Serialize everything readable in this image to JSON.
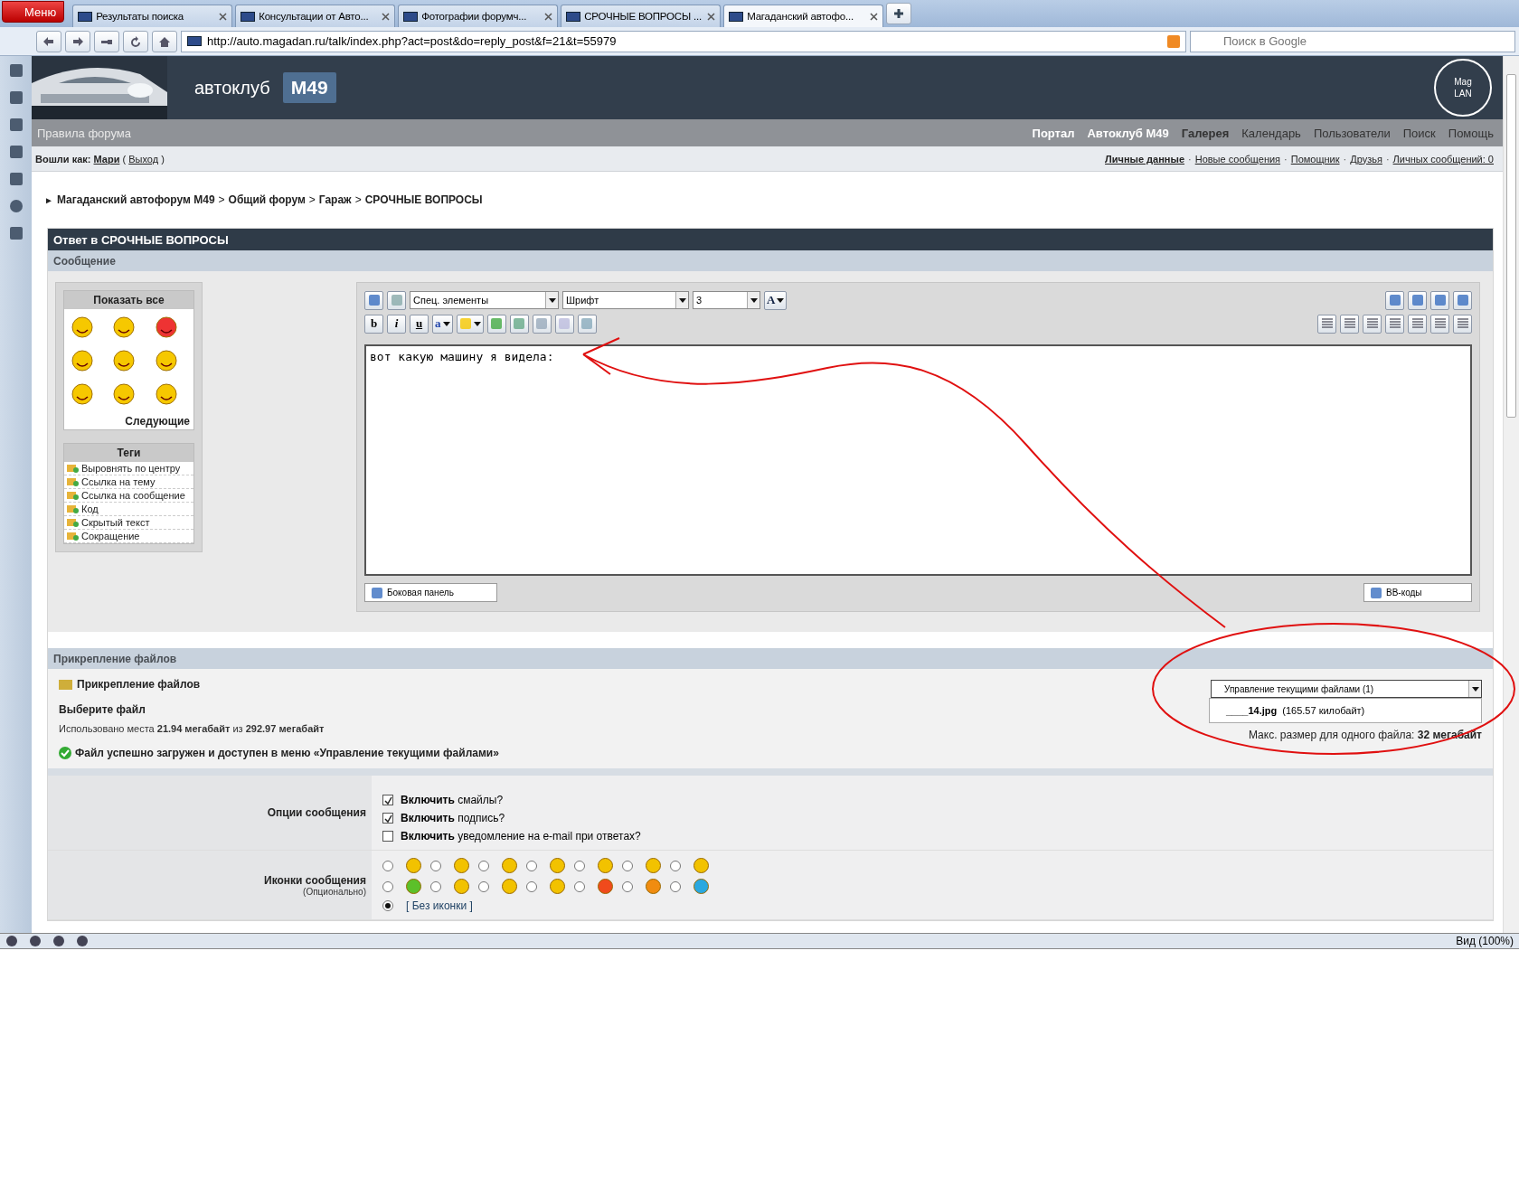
{
  "browser": {
    "menu_button": "Меню",
    "tabs": [
      {
        "label": "Результаты поиска",
        "selected": false
      },
      {
        "label": "Консультации от Авто...",
        "selected": false
      },
      {
        "label": "Фотографии форумч...",
        "selected": false
      },
      {
        "label": "СРОЧНЫЕ ВОПРОСЫ ...",
        "selected": false
      },
      {
        "label": "Магаданский автофо...",
        "selected": true
      }
    ],
    "url": "http://auto.magadan.ru/talk/index.php?act=post&do=reply_post&f=21&t=55979",
    "search_placeholder": "Поиск в Google",
    "zoom": "Вид (100%)"
  },
  "header": {
    "club": "автоклуб",
    "badge": "M49",
    "logo_lines": [
      "Mag",
      "LAN"
    ]
  },
  "nav": {
    "rules": "Правила форума",
    "links": [
      {
        "label": "Портал",
        "kind": "strong"
      },
      {
        "label": "Автоклуб M49",
        "kind": "strong"
      },
      {
        "label": "Галерея",
        "kind": "medium"
      },
      {
        "label": "Календарь",
        "kind": "normal"
      },
      {
        "label": "Пользователи",
        "kind": "normal"
      },
      {
        "label": "Поиск",
        "kind": "normal"
      },
      {
        "label": "Помощь",
        "kind": "normal"
      }
    ]
  },
  "userbar": {
    "label": "Вошли как:",
    "user": "Мари",
    "open": "(",
    "logout": "Выход",
    "close": ")",
    "separator": "·",
    "links": [
      {
        "label": "Личные данные",
        "bold": true
      },
      {
        "label": "Новые сообщения",
        "bold": false
      },
      {
        "label": "Помощник",
        "bold": false
      },
      {
        "label": "Друзья",
        "bold": false
      },
      {
        "label": "Личных сообщений: 0",
        "bold": false
      }
    ]
  },
  "breadcrumb": {
    "marker": "►",
    "separator": ">",
    "items": [
      "Магаданский автофорум M49",
      "Общий форум",
      "Гараж",
      "СРОЧНЫЕ ВОПРОСЫ"
    ]
  },
  "form": {
    "title": "Ответ в СРОЧНЫЕ ВОПРОСЫ",
    "section": "Сообщение"
  },
  "smilies": {
    "header": "Показать все",
    "next": "Следующие"
  },
  "tags": {
    "header": "Теги",
    "items": [
      "Выровнять по центру",
      "Ссылка на тему",
      "Ссылка на сообщение",
      "Код",
      "Скрытый текст",
      "Сокращение"
    ]
  },
  "editor": {
    "selects": [
      "Спец. элементы",
      "Шрифт",
      "3"
    ],
    "color_button": "A",
    "highlight_button": "a",
    "format_buttons": [
      "b",
      "i",
      "u"
    ],
    "text": "вот какую машину я видела:",
    "side_panel_button": "Боковая панель",
    "bbcode_button": "BB-коды"
  },
  "attachments": {
    "header": "Прикрепление файлов",
    "title": "Прикрепление файлов",
    "choose": "Выберите файл",
    "usage": "Использовано места **21.94 мегабайт** из **292.97 мегабайт**",
    "success": "Файл успешно загружен и доступен в меню «Управление текущими файлами»",
    "manage": "Управление текущими файлами (1)",
    "file_name": "____14.jpg",
    "file_size": "(165.57 килобайт)",
    "max_size": "Макс. размер для одного файла: **32 мегабайт**"
  },
  "options": {
    "label": "Опции сообщения",
    "items": [
      {
        "label": "**Включить** смайлы?",
        "checked": true
      },
      {
        "label": "**Включить** подпись?",
        "checked": true
      },
      {
        "label": "**Включить** уведомление на e-mail при ответах?",
        "checked": false
      }
    ]
  },
  "icons": {
    "label": "Иконки сообщения",
    "hint": "(Опционально)",
    "none_label": "[ Без иконки ]",
    "none_selected": true,
    "items": [
      {
        "color": "#f2c200",
        "selected": false
      },
      {
        "color": "#f2c200",
        "selected": false
      },
      {
        "color": "#f2c200",
        "selected": false
      },
      {
        "color": "#f2c200",
        "selected": false
      },
      {
        "color": "#f2c200",
        "selected": false
      },
      {
        "color": "#f2c200",
        "selected": false
      },
      {
        "color": "#f2c200",
        "selected": false
      },
      {
        "color": "#5cc02a",
        "selected": false
      },
      {
        "color": "#f2c200",
        "selected": false
      },
      {
        "color": "#f2c200",
        "selected": false
      },
      {
        "color": "#f2c200",
        "selected": false
      },
      {
        "color": "#f04a1c",
        "selected": false
      },
      {
        "color": "#f08c10",
        "selected": false
      },
      {
        "color": "#2aa8e0",
        "selected": false
      }
    ]
  }
}
